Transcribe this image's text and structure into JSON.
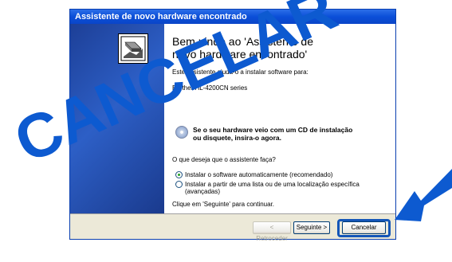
{
  "dialog": {
    "title": "Assistente de novo hardware encontrado",
    "heading": "Bem-vindo ao 'Assistente de novo hardware encontrado'",
    "intro": "Este assistente ajuda-o a instalar software para:",
    "device": "Brother  HL-4200CN series",
    "cd_prompt": "Se o seu hardware veio com um CD de instalação ou disquete, insira-o agora.",
    "question": "O que deseja que o assistente faça?",
    "options": [
      {
        "label": "Instalar o software automaticamente (recomendado)",
        "selected": true
      },
      {
        "label": "Instalar a partir de uma lista ou de uma localização específica (avançadas)",
        "selected": false
      }
    ],
    "continue_text": "Clique em 'Seguinte' para continuar.",
    "buttons": {
      "back": "< Retroceder",
      "next": "Seguinte >",
      "cancel": "Cancelar"
    }
  },
  "overlay": {
    "watermark": "CANCELAR",
    "arrow_color": "#0d5ad0",
    "highlight_color": "#1456b8"
  },
  "icons": [
    "wizard-hardware-icon",
    "cd-icon",
    "arrow-icon"
  ]
}
